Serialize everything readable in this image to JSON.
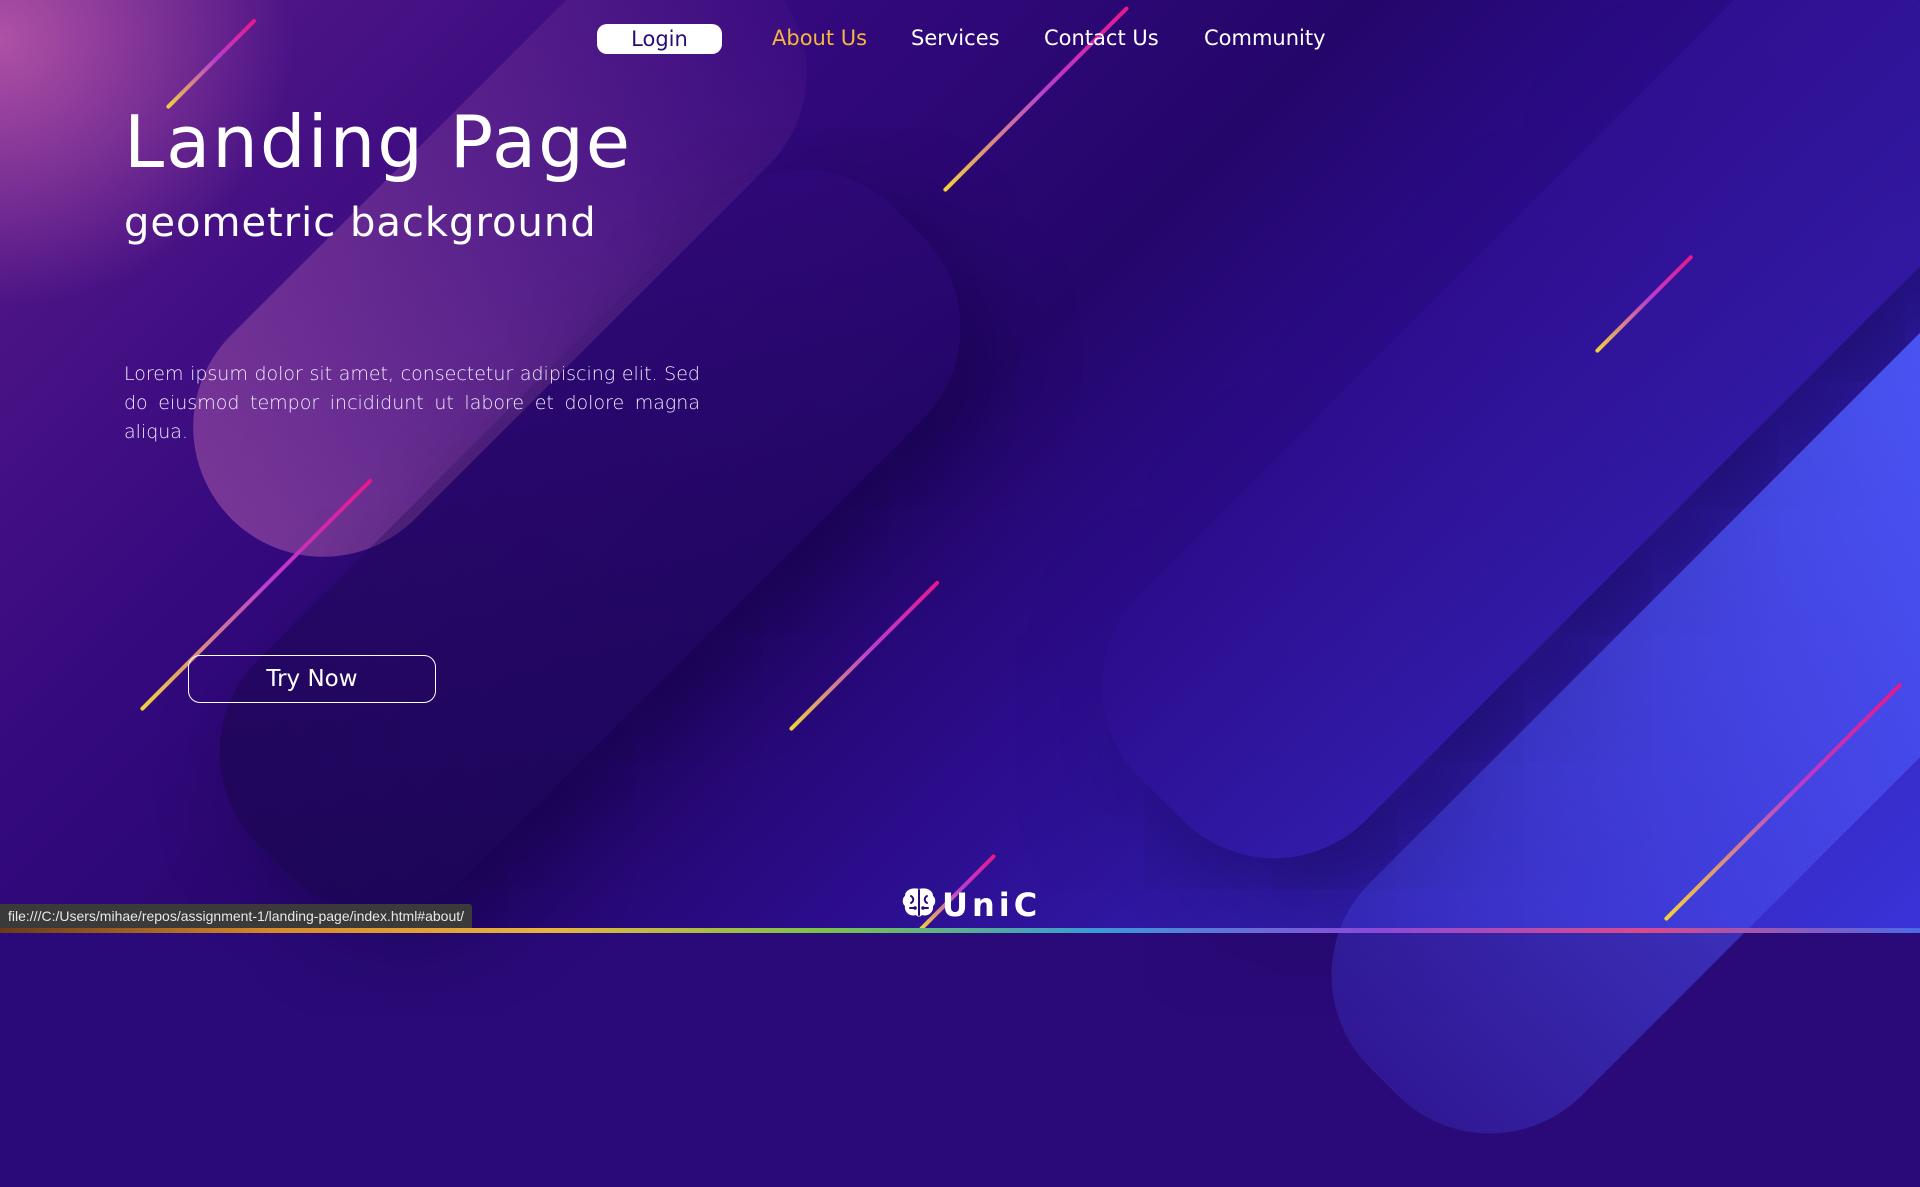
{
  "nav": {
    "login": "Login",
    "links": [
      "About Us",
      "Services",
      "Contact Us",
      "Community"
    ],
    "active": "About Us"
  },
  "hero": {
    "title": "Landing Page",
    "subtitle": "geometric background",
    "body": "Lorem ipsum dolor sit amet, consectetur adipiscing elit. Sed do eiusmod tempor incididunt ut labore et dolore magna aliqua.",
    "cta": "Try Now"
  },
  "brand": {
    "name": "UniC",
    "icon": "brain-icon"
  },
  "status_bar": {
    "url": "file:///C:/Users/mihae/repos/assignment-1/landing-page/index.html#about/"
  },
  "colors": {
    "accent": "#f4b740",
    "background": "#2a0a78",
    "highlight_blue": "#4e5cff"
  }
}
